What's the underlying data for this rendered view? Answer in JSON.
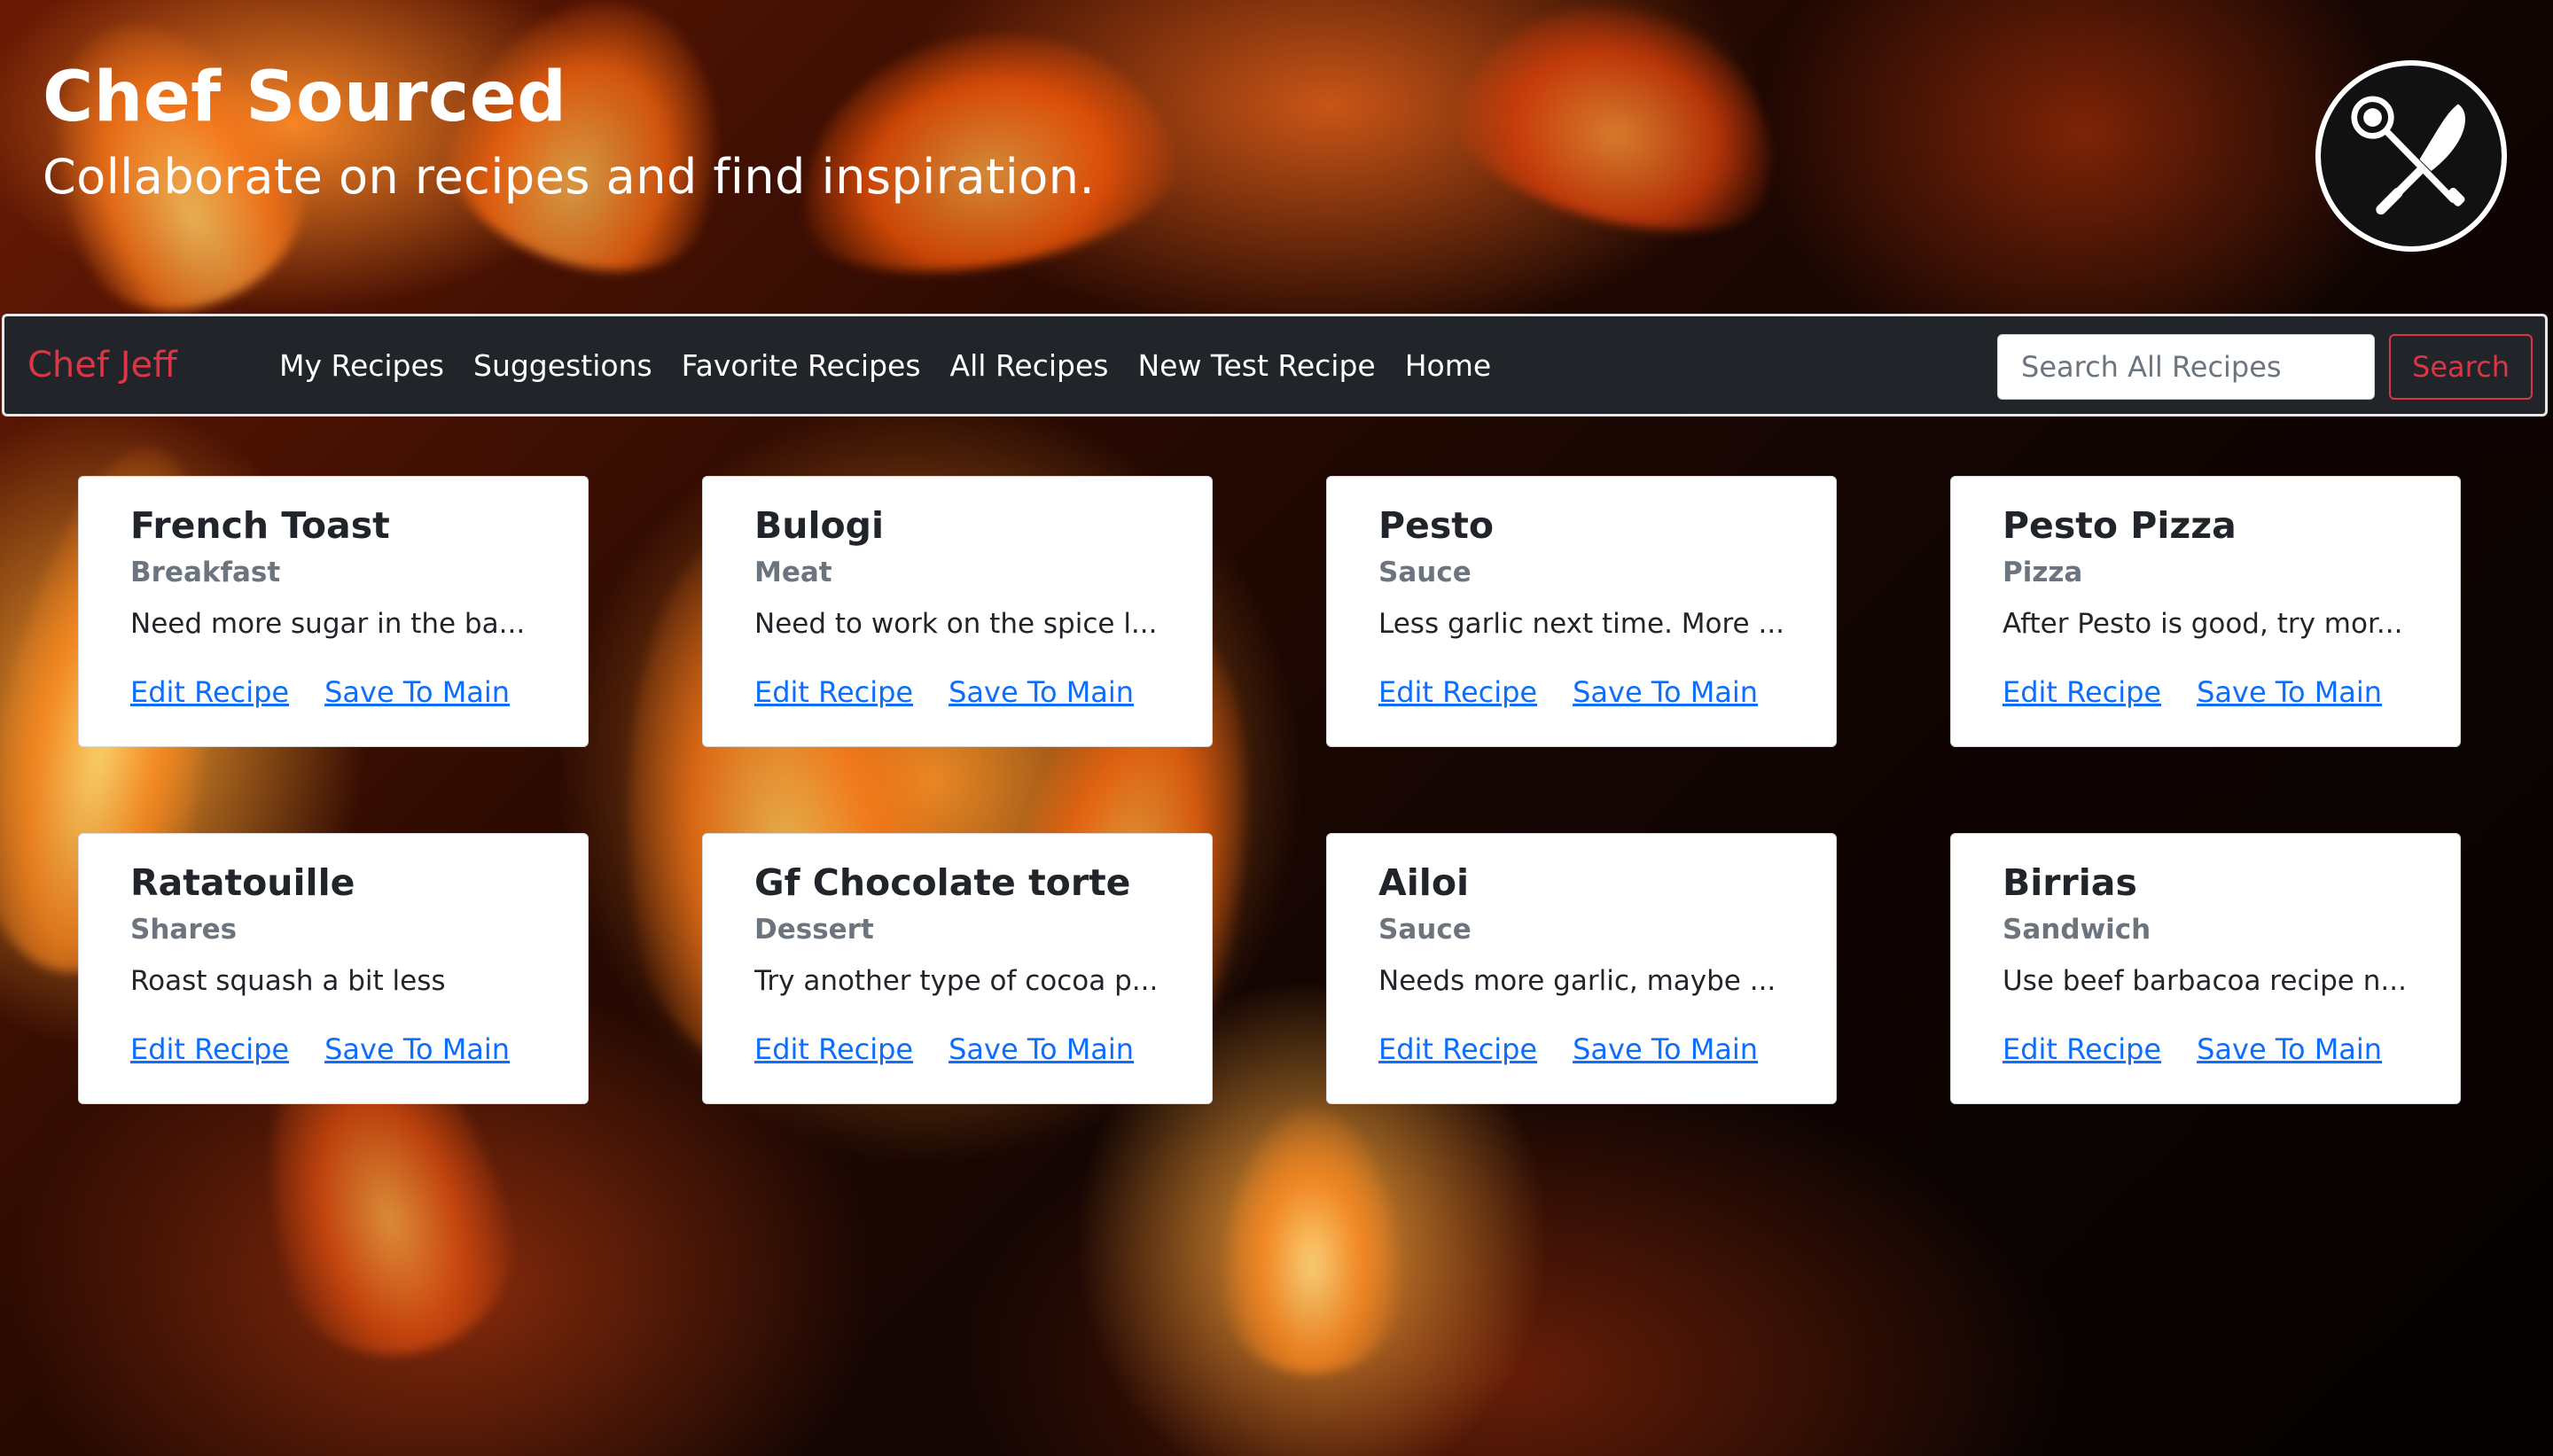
{
  "header": {
    "title": "Chef Sourced",
    "subtitle": "Collaborate on recipes and find inspiration."
  },
  "logo": {
    "icon": "chef-knife-whisk-icon"
  },
  "navbar": {
    "brand": "Chef Jeff",
    "links": [
      "My Recipes",
      "Suggestions",
      "Favorite Recipes",
      "All Recipes",
      "New Test Recipe",
      "Home"
    ],
    "search_placeholder": "Search All Recipes",
    "search_button": "Search"
  },
  "colors": {
    "brand_red": "#dc3545",
    "link_blue": "#0d6efd",
    "navbar_bg": "#212529"
  },
  "cards": [
    {
      "title": "French Toast",
      "category": "Breakfast",
      "note": "Need more sugar in the ba...",
      "edit_label": "Edit Recipe",
      "save_label": "Save To Main"
    },
    {
      "title": "Bulogi",
      "category": "Meat",
      "note": "Need to work on the spice l...",
      "edit_label": "Edit Recipe",
      "save_label": "Save To Main"
    },
    {
      "title": "Pesto",
      "category": "Sauce",
      "note": "Less garlic next time. More ...",
      "edit_label": "Edit Recipe",
      "save_label": "Save To Main"
    },
    {
      "title": "Pesto Pizza",
      "category": "Pizza",
      "note": "After Pesto is good, try mor...",
      "edit_label": "Edit Recipe",
      "save_label": "Save To Main"
    },
    {
      "title": "Ratatouille",
      "category": "Shares",
      "note": "Roast squash a bit less",
      "edit_label": "Edit Recipe",
      "save_label": "Save To Main"
    },
    {
      "title": "Gf Chocolate torte",
      "category": "Dessert",
      "note": "Try another type of cocoa p...",
      "edit_label": "Edit Recipe",
      "save_label": "Save To Main"
    },
    {
      "title": "Ailoi",
      "category": "Sauce",
      "note": "Needs more garlic, maybe ...",
      "edit_label": "Edit Recipe",
      "save_label": "Save To Main"
    },
    {
      "title": "Birrias",
      "category": "Sandwich",
      "note": "Use beef barbacoa recipe n...",
      "edit_label": "Edit Recipe",
      "save_label": "Save To Main"
    }
  ]
}
